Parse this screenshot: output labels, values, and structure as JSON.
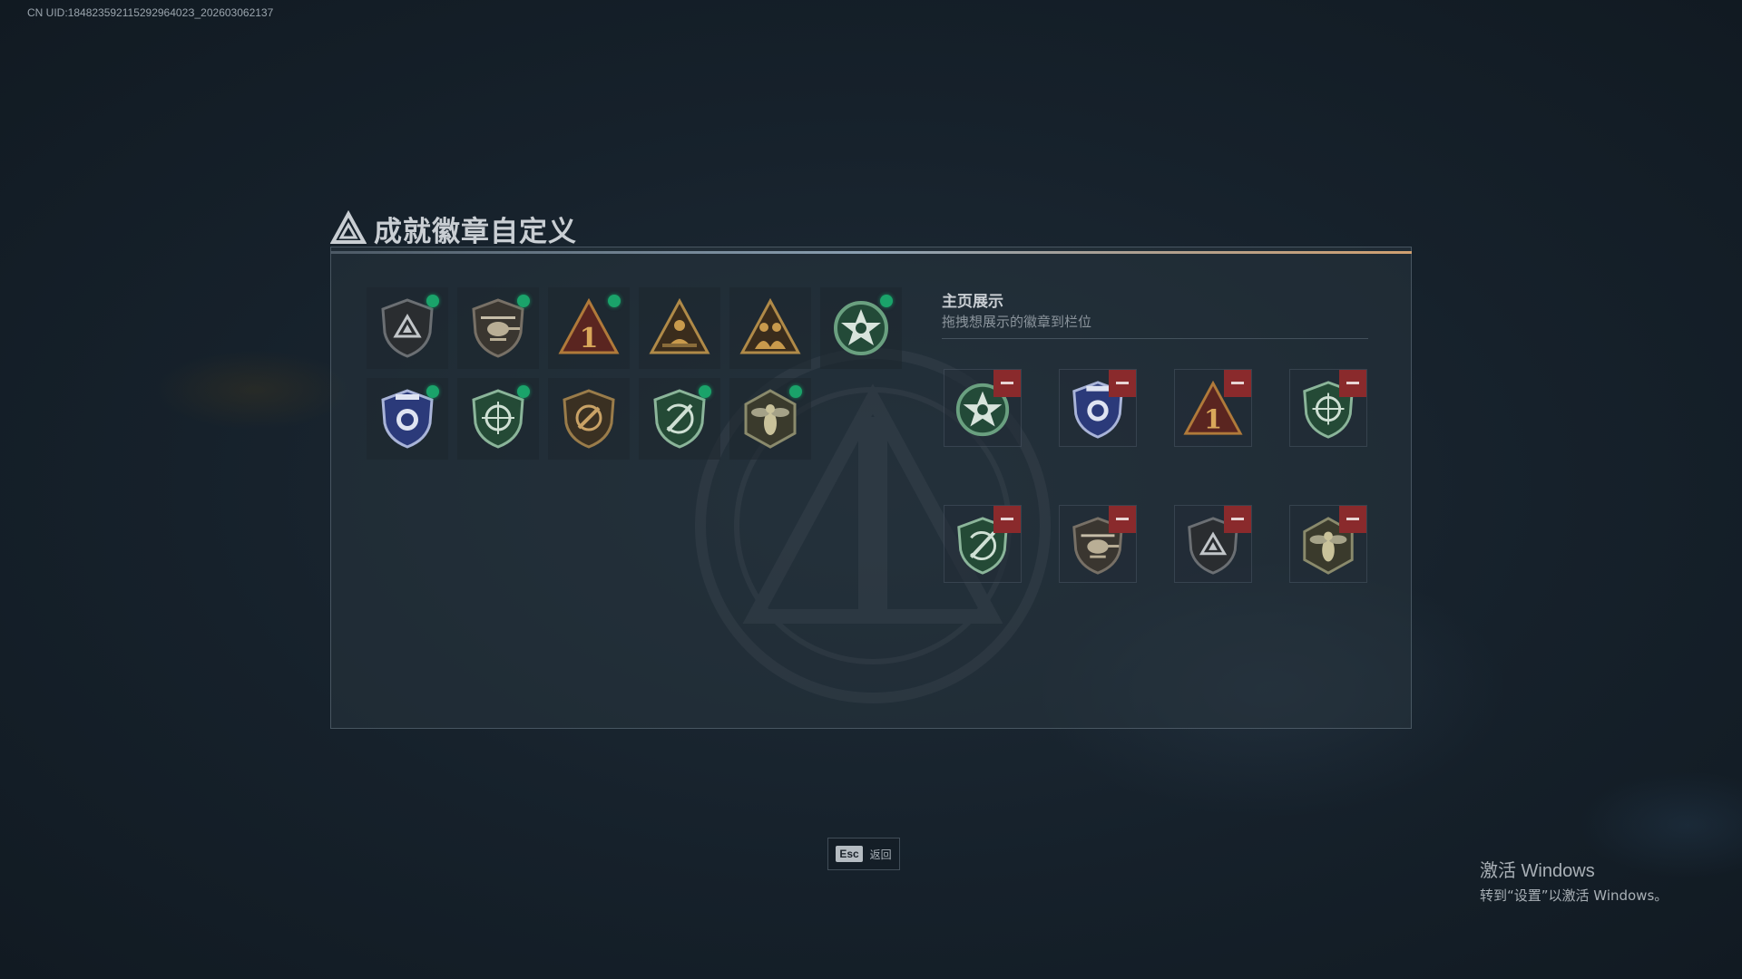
{
  "uid_text": "CN UID:18482359211529296402З_202603062137",
  "title": "成就徽章自定义",
  "owned_badges": [
    {
      "name": "shield-triangle",
      "equipped": true
    },
    {
      "name": "helicopter",
      "equipped": true
    },
    {
      "name": "number-one",
      "equipped": true
    },
    {
      "name": "soldier-triangle",
      "equipped": false
    },
    {
      "name": "squad-triangle",
      "equipped": false
    },
    {
      "name": "star-wreath",
      "equipped": true
    },
    {
      "name": "police-badge",
      "equipped": true
    },
    {
      "name": "green-target-shield",
      "equipped": true
    },
    {
      "name": "bronze-target-shield",
      "equipped": false
    },
    {
      "name": "green-sword-shield",
      "equipped": true
    },
    {
      "name": "wasp-hexagon",
      "equipped": true
    }
  ],
  "display": {
    "title": "主页展示",
    "subtitle": "拖拽想展示的徽章到栏位",
    "slots": [
      "star-wreath",
      "police-badge",
      "number-one",
      "green-target-shield",
      "green-sword-shield",
      "helicopter",
      "shield-triangle",
      "wasp-hexagon"
    ]
  },
  "footer": {
    "key": "Esc",
    "label": "返回"
  },
  "windows_activation": {
    "title": "激活 Windows",
    "subtitle": "转到“设置”以激活 Windows。"
  }
}
